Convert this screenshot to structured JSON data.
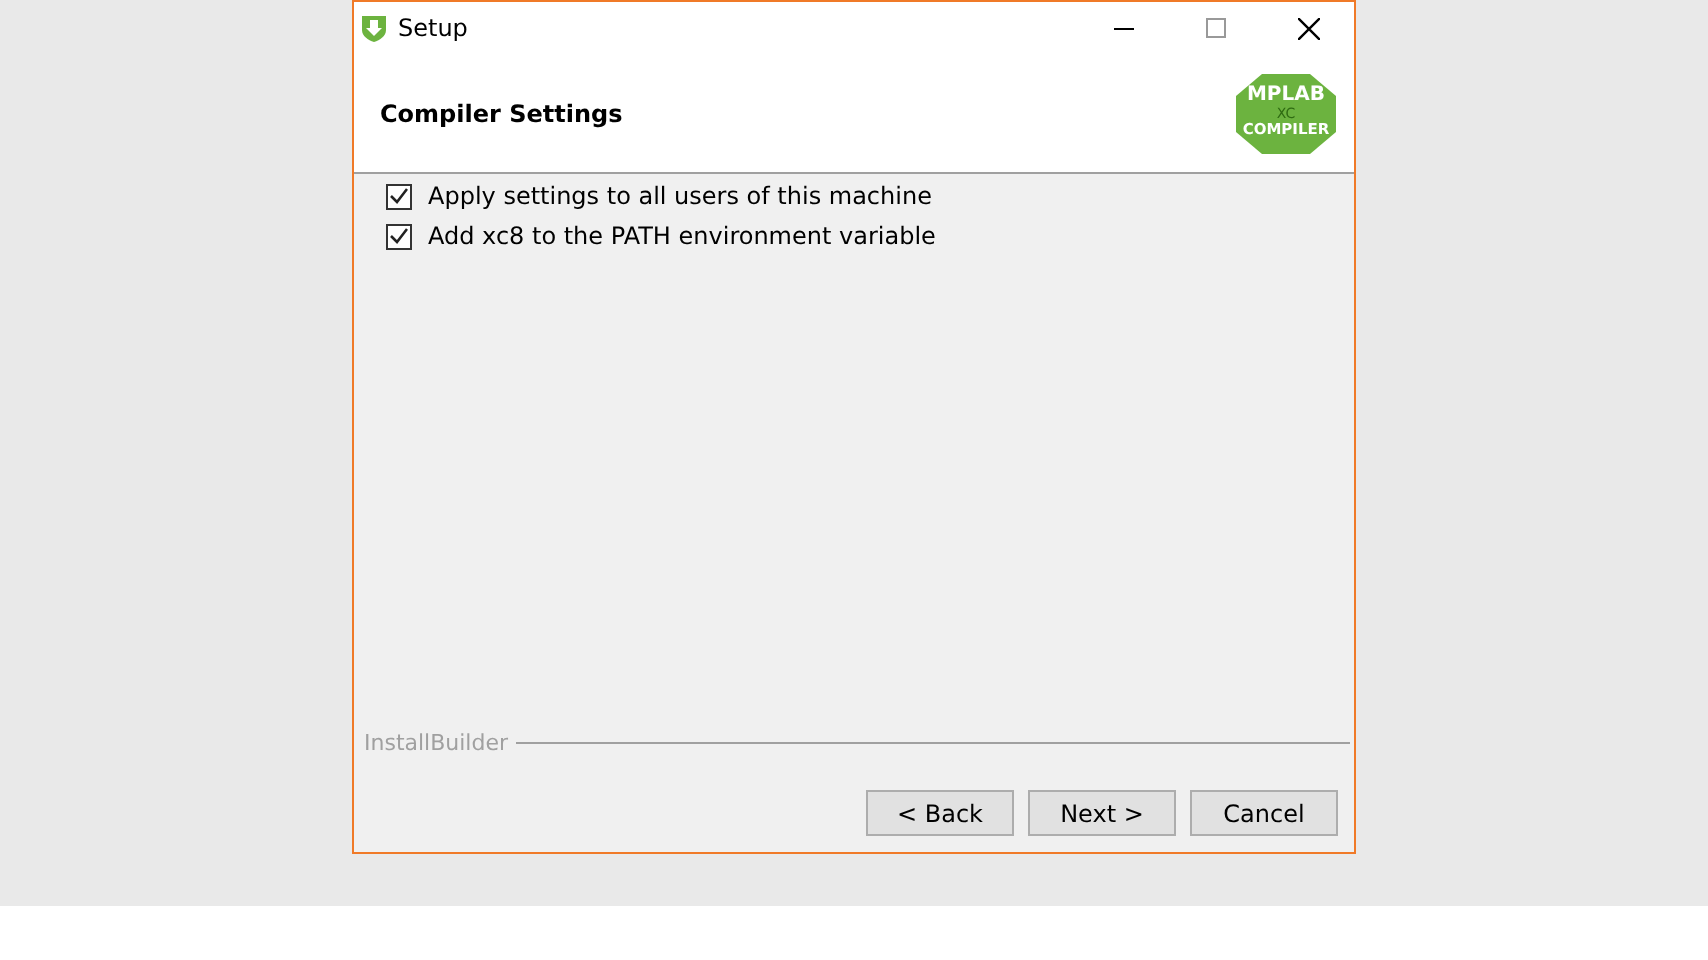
{
  "window": {
    "title": "Setup",
    "controls": [
      {
        "kind": "minimize"
      },
      {
        "kind": "maximize"
      },
      {
        "kind": "close"
      }
    ]
  },
  "header": {
    "title": "Compiler Settings",
    "logo": {
      "top": "MPLAB",
      "middle": "XC",
      "bottom": "COMPILER"
    }
  },
  "options": [
    {
      "label": "Apply settings to all users of this machine",
      "checked": true
    },
    {
      "label": "Add xc8 to the PATH environment variable",
      "checked": true
    }
  ],
  "footer": {
    "brand": "InstallBuilder"
  },
  "buttons": [
    "< Back",
    "Next >",
    "Cancel"
  ]
}
